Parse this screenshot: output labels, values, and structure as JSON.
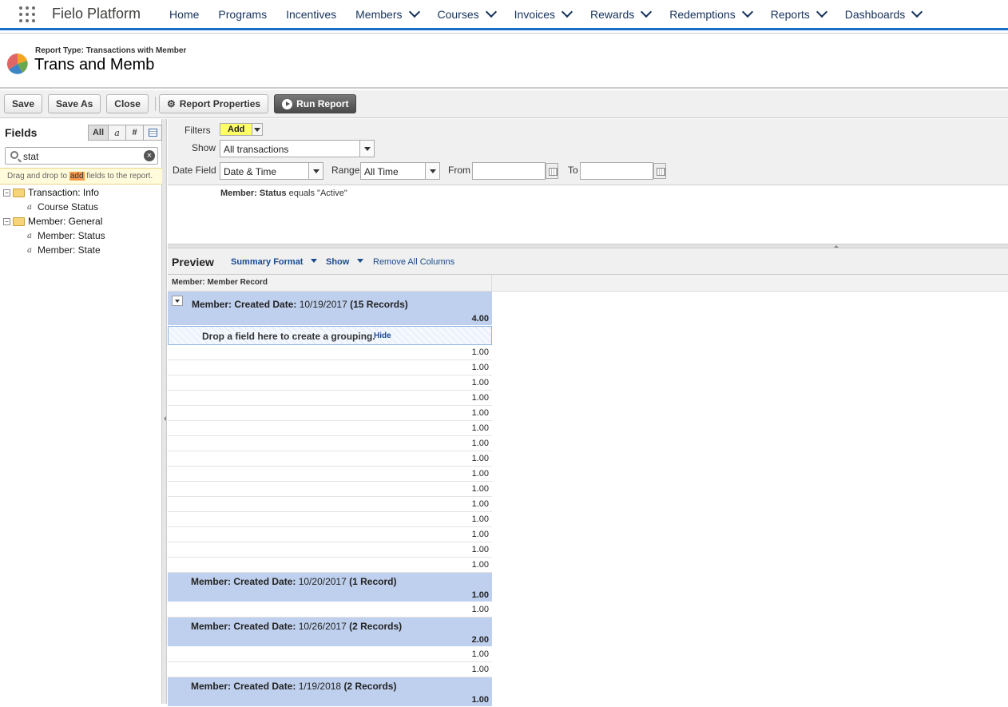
{
  "topnav": {
    "app_name": "Fielo Platform",
    "items": [
      {
        "label": "Home",
        "dropdown": false
      },
      {
        "label": "Programs",
        "dropdown": false
      },
      {
        "label": "Incentives",
        "dropdown": false
      },
      {
        "label": "Members",
        "dropdown": true
      },
      {
        "label": "Courses",
        "dropdown": true
      },
      {
        "label": "Invoices",
        "dropdown": true
      },
      {
        "label": "Rewards",
        "dropdown": true
      },
      {
        "label": "Redemptions",
        "dropdown": true
      },
      {
        "label": "Reports",
        "dropdown": true
      },
      {
        "label": "Dashboards",
        "dropdown": true
      }
    ]
  },
  "header": {
    "report_type": "Report Type: Transactions with Member",
    "title": "Trans and Memb"
  },
  "toolbar": {
    "save": "Save",
    "save_as": "Save As",
    "close": "Close",
    "report_properties": "Report Properties",
    "run_report": "Run Report"
  },
  "fields": {
    "title": "Fields",
    "filter_all": "All",
    "filter_text": "a",
    "filter_number": "#",
    "search_value": "stat",
    "hint_before": "Drag and drop to ",
    "hint_highlight": "add",
    "hint_after": " fields to the report.",
    "folders": [
      {
        "label": "Transaction: Info",
        "items": [
          "Course Status"
        ]
      },
      {
        "label": "Member: General",
        "items": [
          "Member: Status",
          "Member: State"
        ]
      }
    ]
  },
  "filters": {
    "label": "Filters",
    "add": "Add",
    "show_label": "Show",
    "show_value": "All transactions",
    "date_field_label": "Date Field",
    "date_field_value": "Date & Time",
    "range_label": "Range",
    "range_value": "All Time",
    "from_label": "From",
    "to_label": "To",
    "criteria_field": "Member: Status",
    "criteria_rest": " equals \"Active\""
  },
  "preview": {
    "title": "Preview",
    "summary_format": "Summary Format",
    "show": "Show",
    "remove_all": "Remove All Columns",
    "column_header": "Member: Member Record",
    "drop_text": "Drop a field here to create a grouping.",
    "drop_hide": "Hide",
    "groups": [
      {
        "label": "Member: Created Date:",
        "date": " 10/19/2017 ",
        "count": "(15 Records)",
        "total": "4.00",
        "toggle": true,
        "rows": [
          "1.00",
          "1.00",
          "1.00",
          "1.00",
          "1.00",
          "1.00",
          "1.00",
          "1.00",
          "1.00",
          "1.00",
          "1.00",
          "1.00",
          "1.00",
          "1.00",
          "1.00"
        ]
      },
      {
        "label": "Member: Created Date:",
        "date": " 10/20/2017 ",
        "count": "(1 Record)",
        "total": "1.00",
        "toggle": false,
        "rows": [
          "1.00"
        ]
      },
      {
        "label": "Member: Created Date:",
        "date": " 10/26/2017 ",
        "count": "(2 Records)",
        "total": "2.00",
        "toggle": false,
        "rows": [
          "1.00",
          "1.00"
        ]
      },
      {
        "label": "Member: Created Date:",
        "date": " 1/19/2018 ",
        "count": "(2 Records)",
        "total": "1.00",
        "toggle": false,
        "rows": []
      }
    ]
  }
}
